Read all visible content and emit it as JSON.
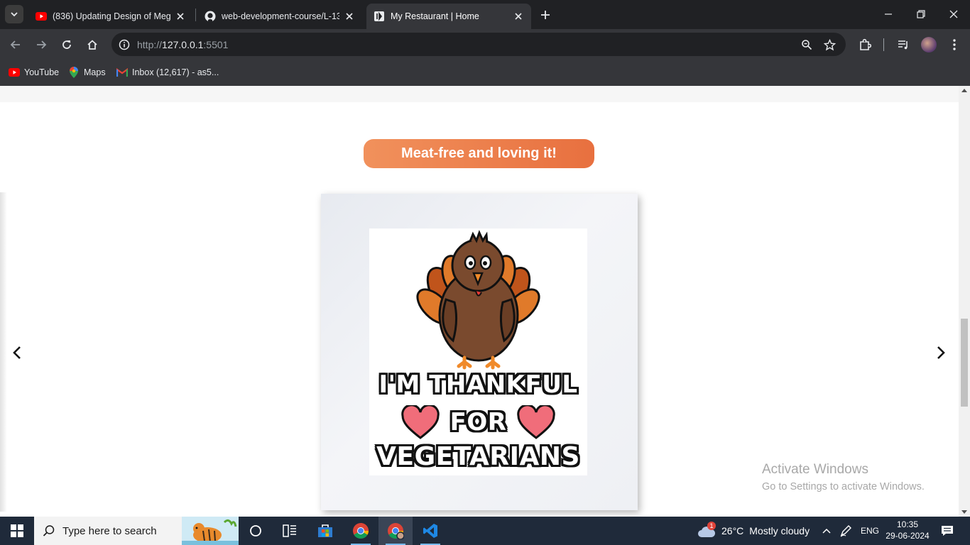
{
  "browser": {
    "tabs": [
      {
        "title": "(836) Updating Design of Mega",
        "icon": "youtube-icon",
        "active": false
      },
      {
        "title": "web-development-course/L-13",
        "icon": "github-icon",
        "active": false
      },
      {
        "title": "My Restaurant | Home",
        "icon": "restaurant-icon",
        "active": true
      }
    ],
    "url": {
      "scheme": "http://",
      "host": "127.0.0.1",
      "port": ":5501"
    },
    "bookmarks": [
      {
        "label": "YouTube",
        "icon": "youtube-icon"
      },
      {
        "label": "Maps",
        "icon": "maps-icon"
      },
      {
        "label": "Inbox (12,617) - as5...",
        "icon": "gmail-icon"
      }
    ]
  },
  "page": {
    "section_heading": "Meat-free and loving it!",
    "poster": {
      "line1": "I'M THANKFUL",
      "line2": "FOR",
      "line3": "VEGETARIANS"
    }
  },
  "watermark": {
    "title": "Activate Windows",
    "subtitle": "Go to Settings to activate Windows."
  },
  "taskbar": {
    "search_placeholder": "Type here to search",
    "weather": {
      "temp": "26°C",
      "condition": "Mostly cloudy",
      "badge": "1"
    },
    "language": "ENG",
    "time": "10:35",
    "date": "29-06-2024"
  },
  "colors": {
    "pill_start": "#f1915c",
    "pill_end": "#e8703f",
    "browser_dark": "#202124",
    "toolbar": "#35363a"
  }
}
